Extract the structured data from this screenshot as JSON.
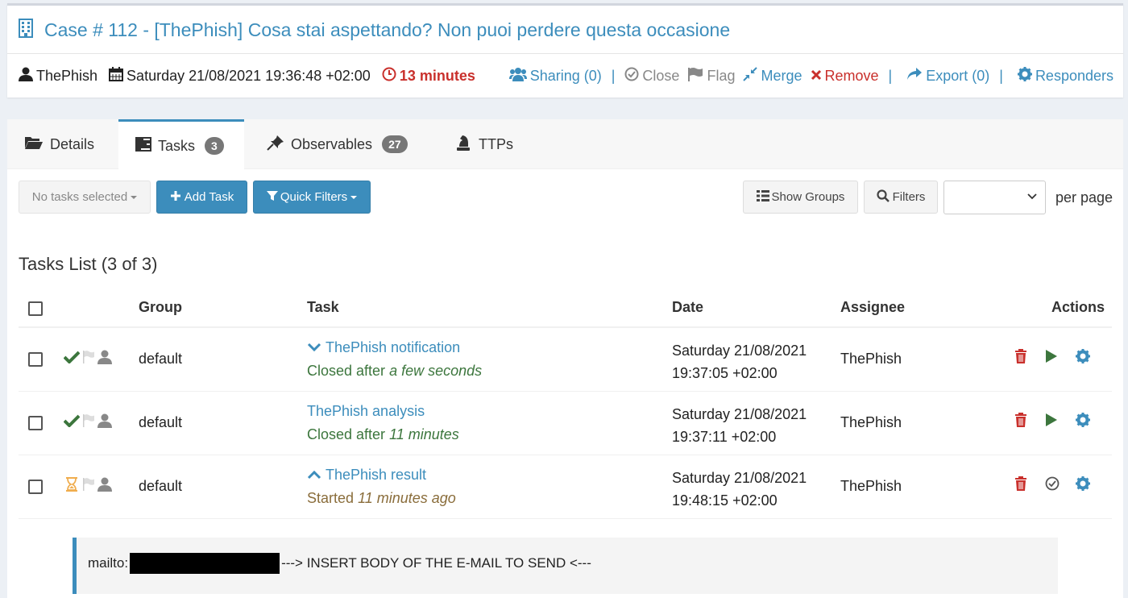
{
  "case": {
    "title": "Case # 112 - [ThePhish] Cosa stai aspettando? Non puoi perdere questa occasione",
    "owner": "ThePhish",
    "date": "Saturday 21/08/2021 19:36:48 +02:00",
    "duration": "13 minutes"
  },
  "actions": {
    "sharing": "Sharing (0)",
    "close": "Close",
    "flag": "Flag",
    "merge": "Merge",
    "remove": "Remove",
    "export": "Export (0)",
    "responders": "Responders",
    "separator": "|"
  },
  "tabs": [
    {
      "label": "Details",
      "icon": "folder-open-icon"
    },
    {
      "label": "Tasks",
      "badge": "3",
      "icon": "tasks-icon"
    },
    {
      "label": "Observables",
      "badge": "27",
      "icon": "thumbtack-icon"
    },
    {
      "label": "TTPs",
      "icon": "chess-knight-icon"
    }
  ],
  "toolbar": {
    "no_selection": "No tasks selected",
    "add_task": "Add Task",
    "quick_filters": "Quick Filters",
    "show_groups": "Show Groups",
    "filters": "Filters",
    "per_page_value": "",
    "per_page_label": "per page"
  },
  "list": {
    "title": "Tasks List (3 of 3)",
    "columns": {
      "group": "Group",
      "task": "Task",
      "date": "Date",
      "assignee": "Assignee",
      "actions": "Actions"
    },
    "rows": [
      {
        "group": "default",
        "name": "ThePhish notification",
        "status_prefix": "Closed after",
        "status_time": "a few seconds",
        "date_line1": "Saturday 21/08/2021",
        "date_line2": "19:37:05 +02:00",
        "assignee": "ThePhish",
        "state": "completed"
      },
      {
        "group": "default",
        "name": "ThePhish analysis",
        "status_prefix": "Closed after",
        "status_time": "11 minutes",
        "date_line1": "Saturday 21/08/2021",
        "date_line2": "19:37:11 +02:00",
        "assignee": "ThePhish",
        "state": "completed"
      },
      {
        "group": "default",
        "name": "ThePhish result",
        "status_prefix": "Started",
        "status_time": "11 minutes ago",
        "date_line1": "Saturday 21/08/2021",
        "date_line2": "19:48:15 +02:00",
        "assignee": "ThePhish",
        "state": "in-progress"
      }
    ]
  },
  "description": {
    "prefix": "mailto:",
    "body": "---> INSERT BODY OF THE E-MAIL TO SEND <---"
  },
  "colors": {
    "accent": "#3c8dbc",
    "danger": "#c9302c",
    "success": "#3c763d",
    "warning": "#f0ad4e"
  }
}
